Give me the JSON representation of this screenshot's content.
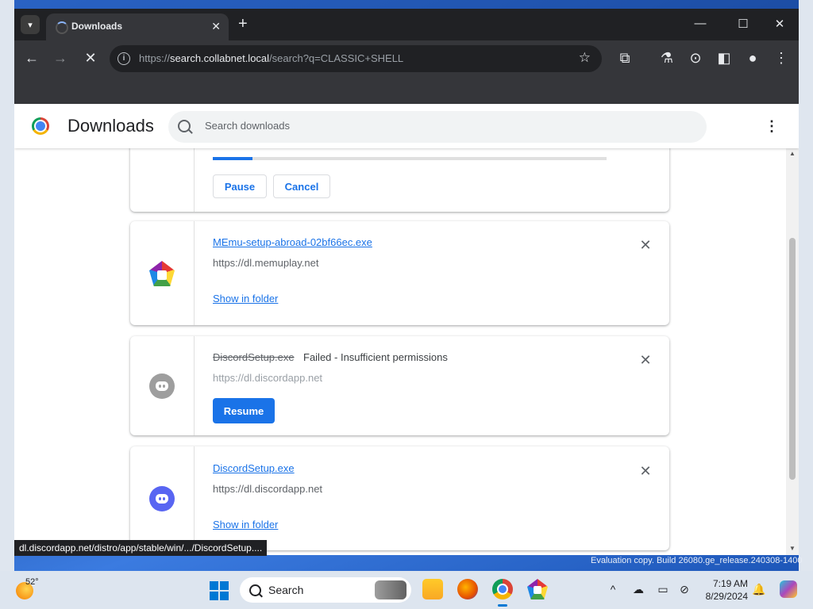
{
  "desktop": {
    "watermark": "Evaluation copy. Build 26080.ge_release.240308-1400"
  },
  "browser": {
    "tab": {
      "title": "Downloads"
    },
    "omnibox": {
      "url_prefix": "https://",
      "url_host": "search.collabnet.local",
      "url_path": "/search?q=CLASSIC+SHELL"
    }
  },
  "page": {
    "title": "Downloads",
    "search": {
      "placeholder": "Search downloads",
      "value": ""
    }
  },
  "downloads": [
    {
      "progress": 0.1,
      "pause_label": "Pause",
      "cancel_label": "Cancel"
    },
    {
      "filename": "MEmu-setup-abroad-02bf66ec.exe",
      "source": "https://dl.memuplay.net",
      "action_label": "Show in folder"
    },
    {
      "filename": "DiscordSetup.exe",
      "status": "Failed - Insufficient permissions",
      "source": "https://dl.discordapp.net",
      "action_label": "Resume"
    },
    {
      "filename": "DiscordSetup.exe",
      "source": "https://dl.discordapp.net",
      "action_label": "Show in folder"
    }
  ],
  "status_tooltip": "dl.discordapp.net/distro/app/stable/win/.../DiscordSetup....",
  "taskbar": {
    "weather_temp": "52°",
    "search_label": "Search",
    "time": "7:19 AM",
    "date": "8/29/2024"
  },
  "icons": {
    "accent": "#1a73e8",
    "discord_blue": "#5865f2",
    "titlebar_bg": "#202124"
  }
}
